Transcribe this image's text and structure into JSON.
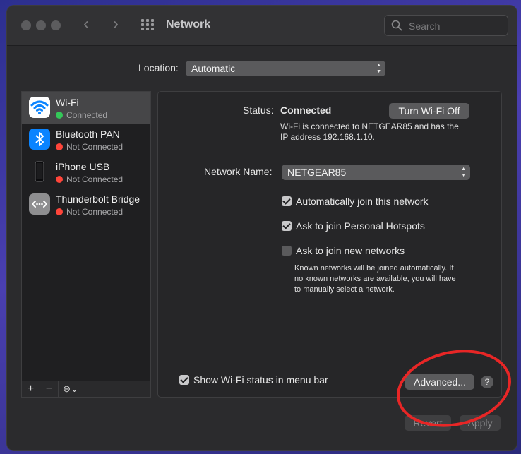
{
  "window": {
    "title": "Network"
  },
  "search": {
    "placeholder": "Search"
  },
  "location": {
    "label": "Location:",
    "value": "Automatic"
  },
  "services": [
    {
      "name": "Wi-Fi",
      "status": "Connected",
      "status_color": "#34c759"
    },
    {
      "name": "Bluetooth PAN",
      "status": "Not Connected",
      "status_color": "#ff453a"
    },
    {
      "name": "iPhone USB",
      "status": "Not Connected",
      "status_color": "#ff453a"
    },
    {
      "name": "Thunderbolt Bridge",
      "status": "Not Connected",
      "status_color": "#ff453a"
    }
  ],
  "sidebar_tools": {
    "add": "+",
    "remove": "−",
    "action": "⊖⌄"
  },
  "detail": {
    "status_label": "Status:",
    "status_value": "Connected",
    "toggle_button": "Turn Wi-Fi Off",
    "status_desc_line1": "Wi-Fi is connected to NETGEAR85 and has the",
    "status_desc_line2": "IP address 192.168.1.10.",
    "network_name_label": "Network Name:",
    "network_name_value": "NETGEAR85",
    "auto_join_label": "Automatically join this network",
    "hotspots_label": "Ask to join Personal Hotspots",
    "new_networks_label": "Ask to join new networks",
    "new_networks_desc_line1": "Known networks will be joined automatically. If",
    "new_networks_desc_line2": "no known networks are available, you will have",
    "new_networks_desc_line3": "to manually select a network.",
    "show_status_label": "Show Wi-Fi status in menu bar",
    "advanced_button": "Advanced...",
    "help": "?"
  },
  "footer": {
    "revert": "Revert",
    "apply": "Apply"
  },
  "colors": {
    "annotation": "#e82626",
    "accent": "#0a84ff"
  }
}
